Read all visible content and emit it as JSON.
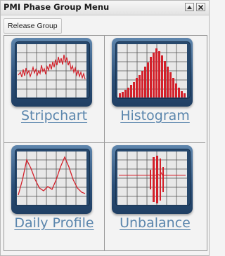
{
  "window": {
    "title": "PMI Phase Group Menu"
  },
  "toolbar": {
    "release_label": "Release Group"
  },
  "tiles": [
    {
      "label": "Stripchart",
      "icon": "stripchart-icon"
    },
    {
      "label": "Histogram",
      "icon": "histogram-icon"
    },
    {
      "label": "Daily Profile",
      "icon": "daily-profile-icon"
    },
    {
      "label": "Unbalance",
      "icon": "unbalance-icon"
    }
  ],
  "colors": {
    "accent": "#5b86ad",
    "trace": "#d3202a",
    "monitor": "#2b4f78"
  }
}
